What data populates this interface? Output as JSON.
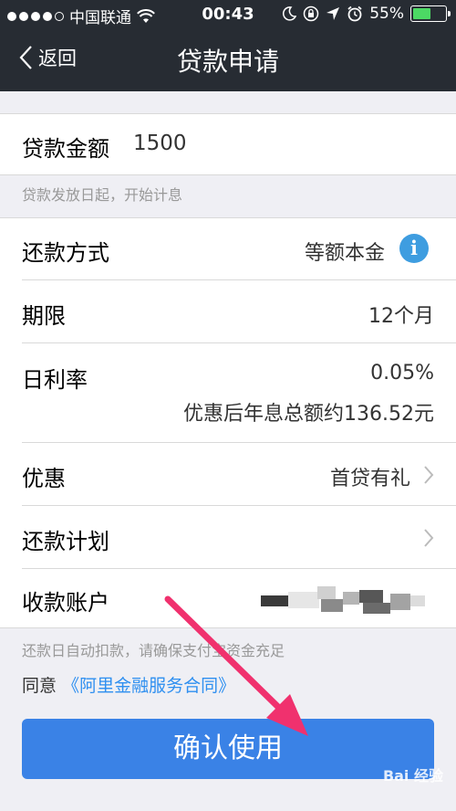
{
  "status_bar": {
    "carrier": "中国联通",
    "time": "00:43",
    "battery": "55%",
    "battery_level": 0.55
  },
  "nav": {
    "back_label": "返回",
    "title": "贷款申请"
  },
  "amount": {
    "label": "贷款金额",
    "value": "1500",
    "note": "贷款发放日起，开始计息"
  },
  "repay_method": {
    "label": "还款方式",
    "value": "等额本金"
  },
  "term": {
    "label": "期限",
    "value": "12个月"
  },
  "daily_rate": {
    "label": "日利率",
    "value": "0.05%",
    "detail": "优惠后年息总额约136.52元"
  },
  "discount": {
    "label": "优惠",
    "value": "首贷有礼"
  },
  "repay_plan": {
    "label": "还款计划"
  },
  "account": {
    "label": "收款账户"
  },
  "auto_debit_note": "还款日自动扣款，请确保支付宝资金充足",
  "agreement": {
    "prefix": "同意",
    "link": "《阿里金融服务合同》"
  },
  "confirm_label": "确认使用",
  "watermark": "Bai 经验",
  "colors": {
    "header": "#272c33",
    "accent": "#3a82e6",
    "link": "#2e8ff0",
    "arrow": "#f0316e"
  }
}
